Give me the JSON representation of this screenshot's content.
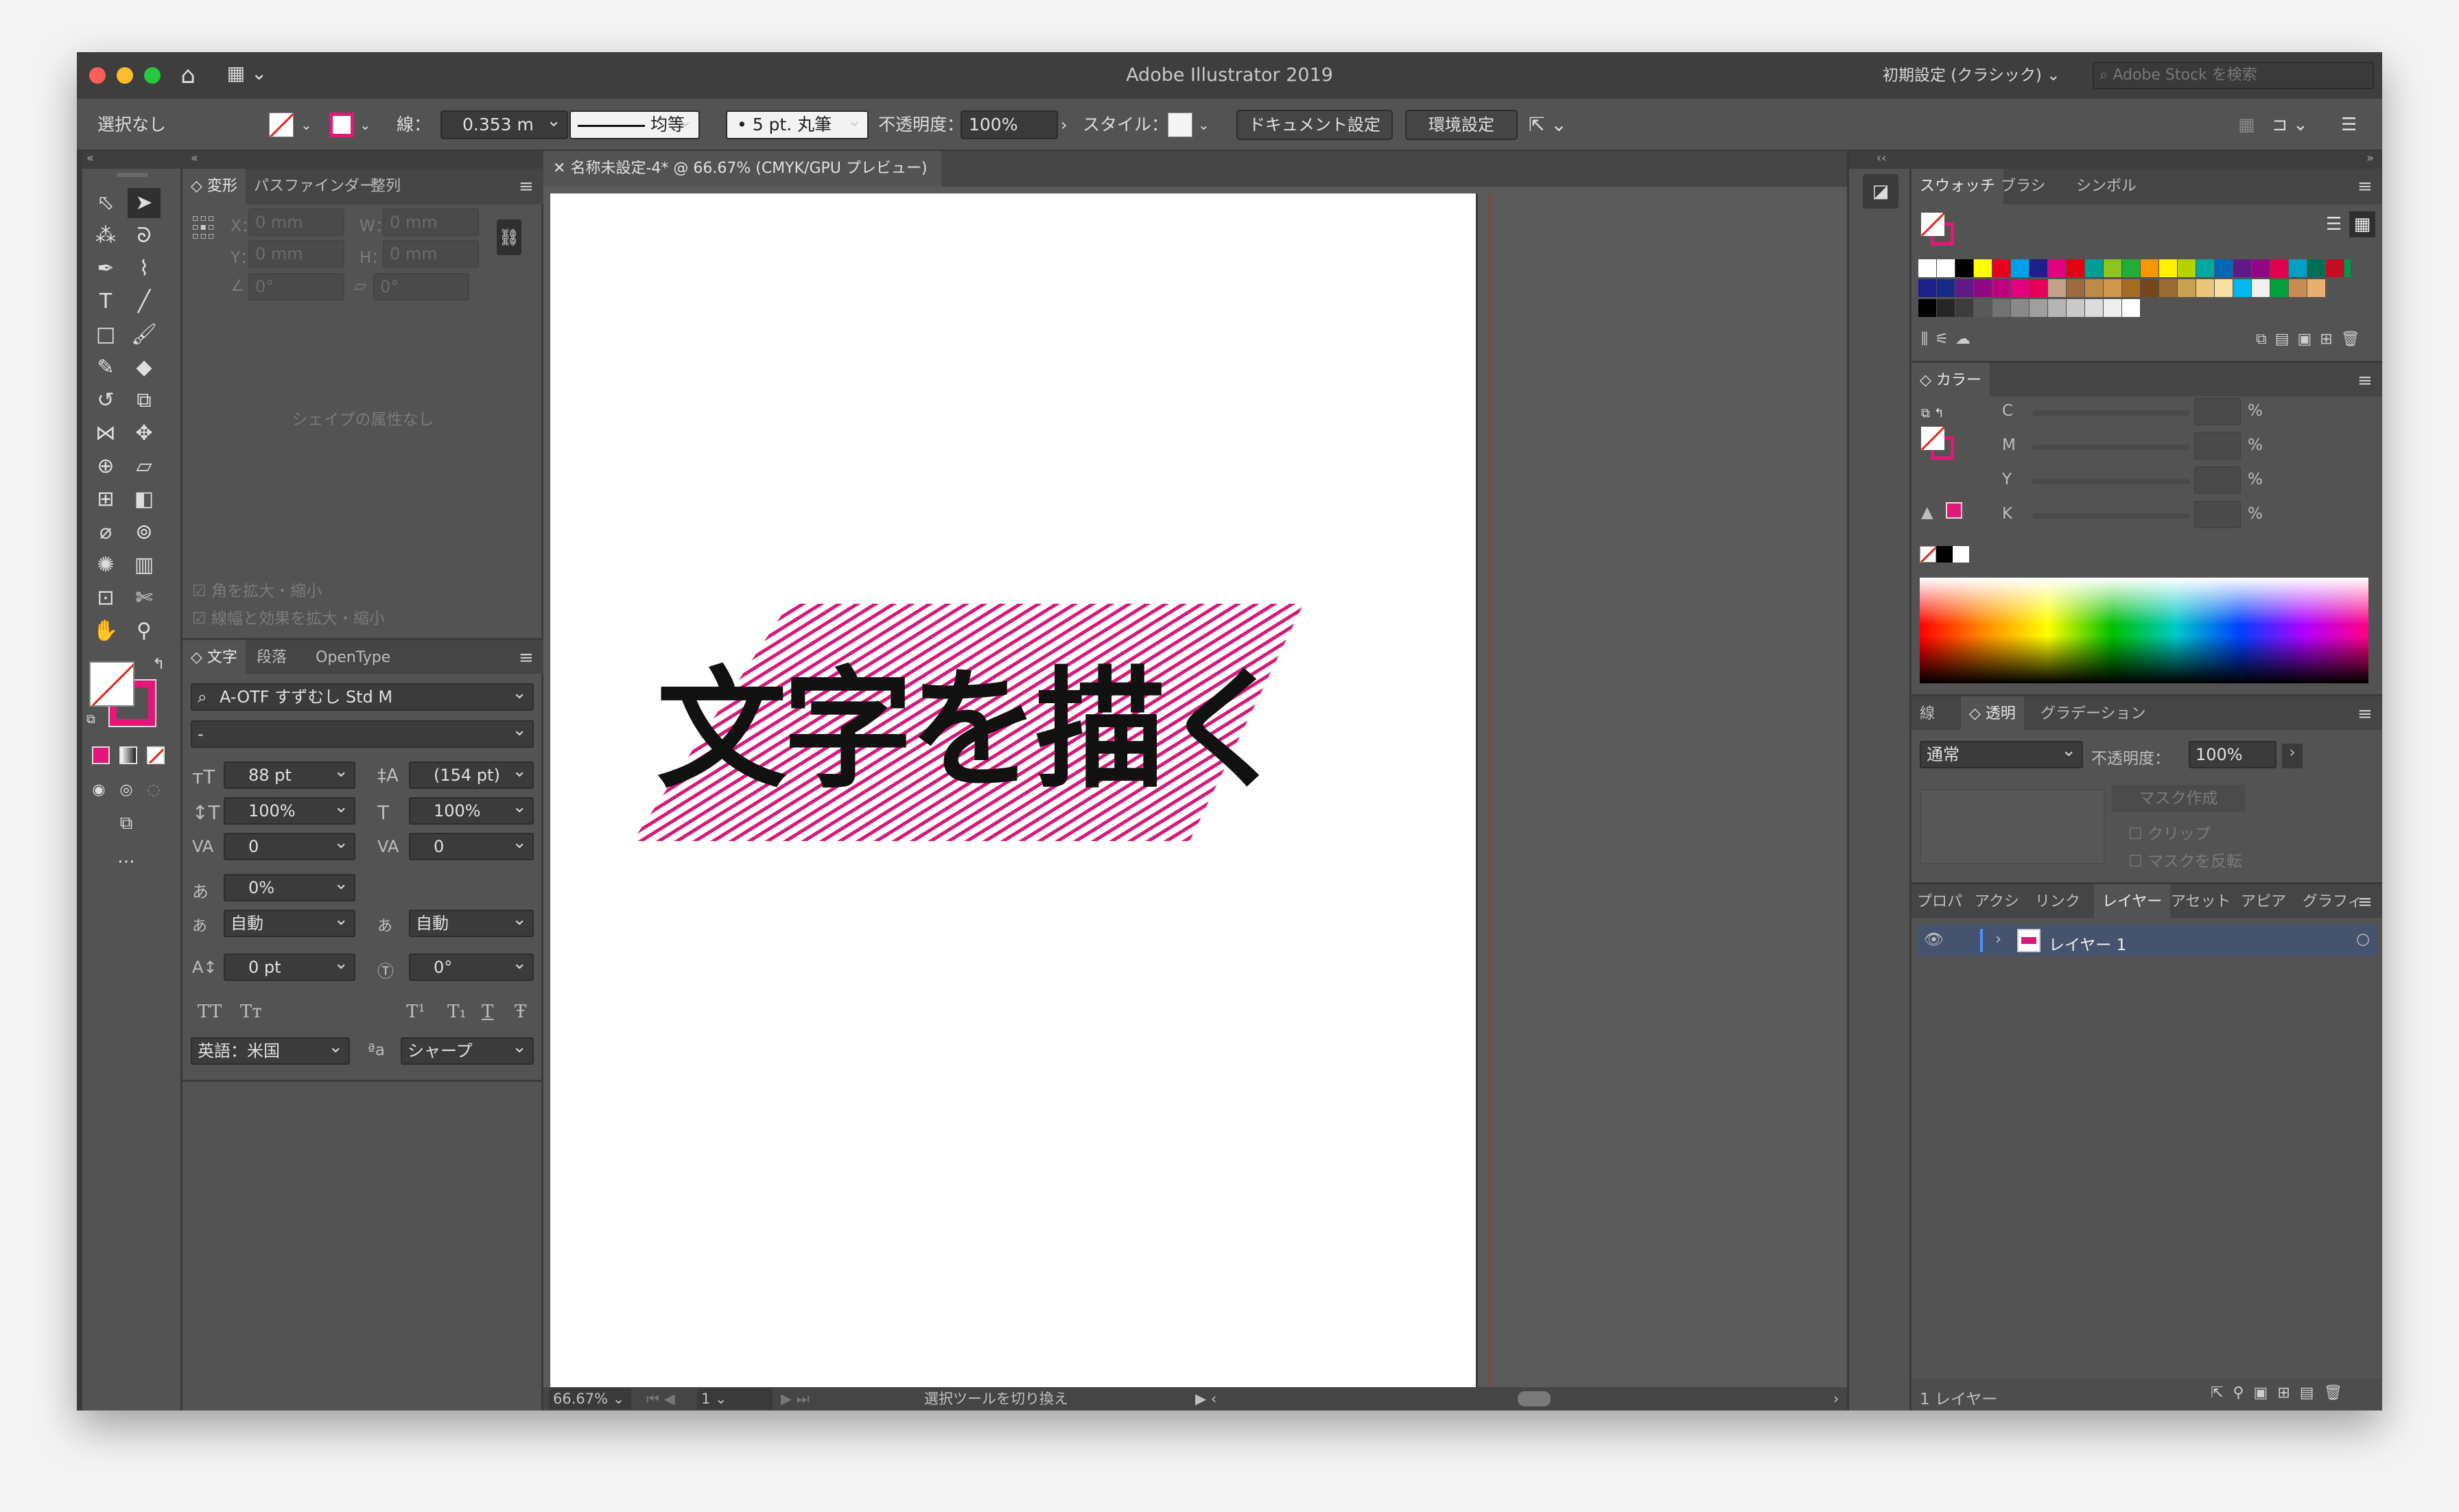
{
  "app": {
    "title": "Adobe Illustrator 2019",
    "workspace": "初期設定 (クラシック)",
    "stock_search_placeholder": "Adobe Stock を検索"
  },
  "control_bar": {
    "selection": "選択なし",
    "stroke_label": "線：",
    "stroke_weight": "0.353 m",
    "profile": "均等",
    "brush": "5 pt. 丸筆",
    "opacity_label": "不透明度：",
    "opacity": "100%",
    "style_label": "スタイル：",
    "doc_setup": "ドキュメント設定",
    "prefs": "環境設定"
  },
  "transform_panel": {
    "tabs": [
      "変形",
      "パスファインダー",
      "整列"
    ],
    "x_label": "X：",
    "y_label": "Y：",
    "w_label": "W：",
    "h_label": "H：",
    "x": "0 mm",
    "y": "0 mm",
    "w": "0 mm",
    "h": "0 mm",
    "angle": "0°",
    "shear": "0°",
    "no_shape": "シェイプの属性なし",
    "scale_corners": "角を拡大・縮小",
    "scale_strokes": "線幅と効果を拡大・縮小"
  },
  "character_panel": {
    "tabs": [
      "文字",
      "段落",
      "OpenType"
    ],
    "font": "A-OTF すずむし Std M",
    "style": "-",
    "size": "88 pt",
    "leading": "(154 pt)",
    "vscale": "100%",
    "hscale": "100%",
    "kerning": "0",
    "tracking": "0",
    "tsume": "0%",
    "aki_left": "自動",
    "aki_right": "自動",
    "baseline": "0 pt",
    "rotation": "0°",
    "language": "英語：米国",
    "antialias": "シャープ",
    "glyph_buttons": [
      "TT",
      "Tт",
      "T¹",
      "T₁",
      "T",
      "Ŧ"
    ]
  },
  "document": {
    "tab_title": "名称未設定-4* @ 66.67% (CMYK/GPU プレビュー)",
    "artwork_text": "文字を描く",
    "artwork_color": "#d6197a",
    "zoom": "66.67%",
    "artboard": "1",
    "status": "選択ツールを切り換え"
  },
  "swatches_panel": {
    "tabs": [
      "スウォッチ",
      "ブラシ",
      "シンボル"
    ]
  },
  "color_panel": {
    "title": "カラー",
    "channels": [
      "C",
      "M",
      "Y",
      "K"
    ],
    "unit": "%"
  },
  "transparency_panel": {
    "tabs": [
      "線",
      "透明",
      "グラデーション"
    ],
    "blend": "通常",
    "opacity_label": "不透明度：",
    "opacity": "100%",
    "make_mask": "マスク作成",
    "clip": "クリップ",
    "invert": "マスクを反転"
  },
  "layers_panel": {
    "tabs": [
      "プロパ",
      "アクシ",
      "リンク",
      "レイヤー",
      "アセット",
      "アピア",
      "グラフィ"
    ],
    "layer_name": "レイヤー 1",
    "count": "1 レイヤー"
  },
  "colors": {
    "accent": "#e3177a",
    "panel": "#535353",
    "dark": "#3a3a3a"
  }
}
